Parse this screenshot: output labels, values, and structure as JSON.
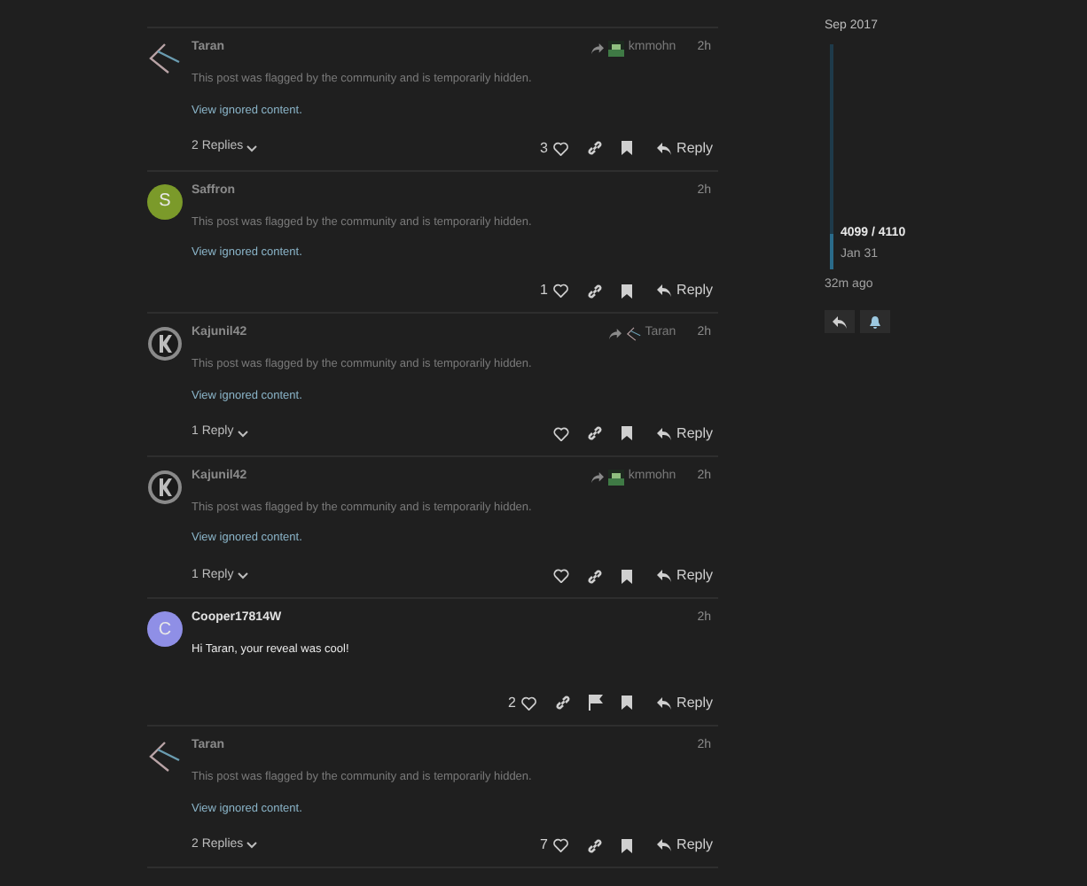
{
  "posts": [
    {
      "username": "Taran",
      "avatar": {
        "kind": "stick"
      },
      "reply_to": {
        "name": "kmmohn",
        "kind": "picture"
      },
      "time": "2h",
      "hidden": true,
      "text": "This post was flagged by the community and is temporarily hidden.",
      "link": "View ignored content.",
      "replies": "2 Replies",
      "likes": "3",
      "flag": false,
      "reply_label": "Reply"
    },
    {
      "username": "Saffron",
      "avatar": {
        "kind": "letter",
        "letter": "S",
        "color": "#7b9a2a"
      },
      "time": "2h",
      "hidden": true,
      "text": "This post was flagged by the community and is temporarily hidden.",
      "link": "View ignored content.",
      "likes": "1",
      "flag": false,
      "reply_label": "Reply"
    },
    {
      "username": "Kajunil42",
      "avatar": {
        "kind": "k-logo"
      },
      "reply_to": {
        "name": "Taran",
        "kind": "stick"
      },
      "time": "2h",
      "hidden": true,
      "text": "This post was flagged by the community and is temporarily hidden.",
      "link": "View ignored content.",
      "replies": "1 Reply",
      "flag": false,
      "reply_label": "Reply"
    },
    {
      "username": "Kajunil42",
      "avatar": {
        "kind": "k-logo"
      },
      "reply_to": {
        "name": "kmmohn",
        "kind": "picture"
      },
      "time": "2h",
      "hidden": true,
      "text": "This post was flagged by the community and is temporarily hidden.",
      "link": "View ignored content.",
      "replies": "1 Reply",
      "flag": false,
      "reply_label": "Reply"
    },
    {
      "username": "Cooper17814W",
      "avatar": {
        "kind": "letter",
        "letter": "C",
        "color": "#8f8fe6"
      },
      "time": "2h",
      "hidden": false,
      "text": "Hi Taran, your reveal was cool!",
      "likes": "2",
      "flag": true,
      "reply_label": "Reply"
    },
    {
      "username": "Taran",
      "avatar": {
        "kind": "stick"
      },
      "time": "2h",
      "hidden": true,
      "text": "This post was flagged by the community and is temporarily hidden.",
      "link": "View ignored content.",
      "replies": "2 Replies",
      "likes": "7",
      "flag": false,
      "reply_label": "Reply"
    }
  ],
  "timeline": {
    "start": "Sep 2017",
    "position": "4099 / 4110",
    "date": "Jan 31",
    "level": 0.15,
    "last_activity": "32m ago"
  }
}
